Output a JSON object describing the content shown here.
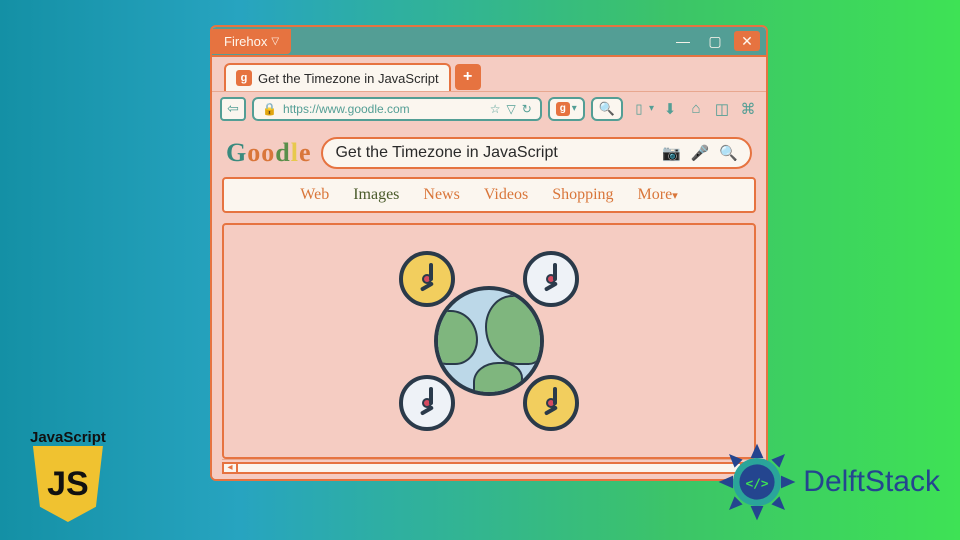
{
  "browser_name": "Firehox",
  "tab": {
    "title": "Get the Timezone in JavaScript",
    "favicon_letter": "g"
  },
  "url": "https://www.goodle.com",
  "logo_letters": [
    "G",
    "o",
    "o",
    "d",
    "l",
    "e"
  ],
  "search_query": "Get the Timezone in JavaScript",
  "nav": {
    "web": "Web",
    "images": "Images",
    "news": "News",
    "videos": "Videos",
    "shopping": "Shopping",
    "more": "More"
  },
  "js_badge": {
    "label": "JavaScript",
    "shield": "JS"
  },
  "delft": {
    "text": "DelftStack"
  },
  "icons": {
    "star": "☆",
    "dropdown": "▽",
    "refresh": "↻",
    "lock": "🔒",
    "search": "🔍",
    "camera": "📷",
    "mic": "🎤",
    "book": "▯",
    "download": "⬇",
    "home": "⌂",
    "cube": "◫",
    "clover": "⌘",
    "plus": "+",
    "min": "—",
    "max": "▢",
    "close": "✕",
    "back": "⇦",
    "code": "</>"
  }
}
